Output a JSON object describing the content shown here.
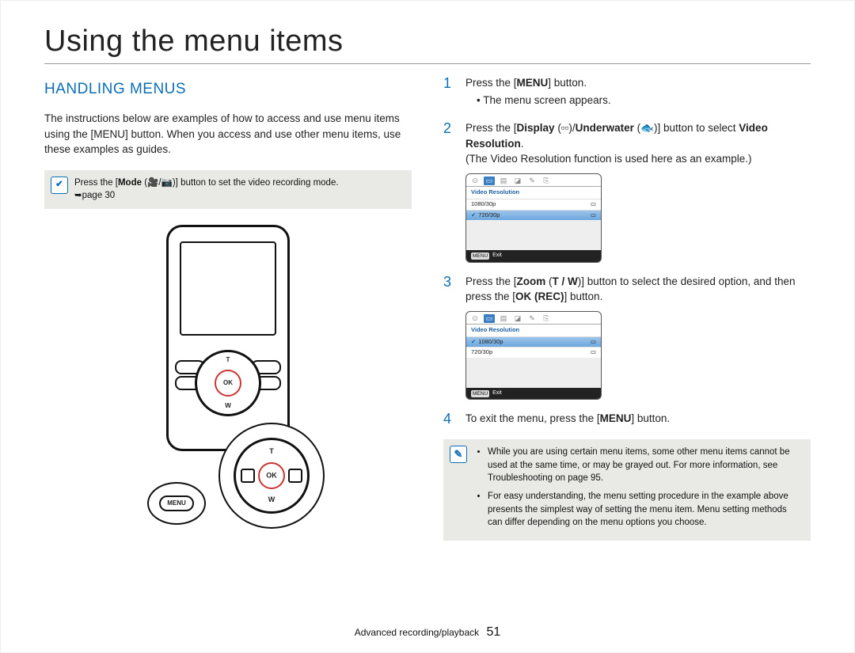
{
  "title": "Using the menu items",
  "section": "HANDLING MENUS",
  "intro": "The instructions below are examples of how to access and use menu items using the [MENU] button. When you access and use other menu items, use these examples as guides.",
  "mode_note": {
    "line1_a": "Press the [",
    "line1_b": "Mode",
    "line1_c": " (🎥/📷)] button to set the video recording mode.",
    "page_ref": "➥page 30"
  },
  "device": {
    "menu_label": "MENU",
    "t": "T",
    "w": "W",
    "ok": "OK"
  },
  "steps": {
    "s1": {
      "num": "1",
      "text_a": "Press the [",
      "text_b": "MENU",
      "text_c": "] button.",
      "bullet": "The menu screen appears."
    },
    "s2": {
      "num": "2",
      "text_a": "Press the [",
      "text_b": "Display",
      "text_c": " (▫▫)/",
      "text_d": "Underwater",
      "text_e": " (🐟)] button to select ",
      "text_f": "Video Resolution",
      "text_g": ".",
      "paren": "(The Video Resolution function is used here as an example.)"
    },
    "s3": {
      "num": "3",
      "text_a": "Press the [",
      "text_b": "Zoom",
      "text_c": " (",
      "text_d": "T / W",
      "text_e": ")] button to select the desired option, and then press the [",
      "text_f": "OK (REC)",
      "text_g": "] button."
    },
    "s4": {
      "num": "4",
      "text_a": "To exit the menu, press the [",
      "text_b": "MENU",
      "text_c": "] button."
    }
  },
  "mini1": {
    "title": "Video Resolution",
    "row1": "1080/30p",
    "row2": "720/30p",
    "exit_btn": "MENU",
    "exit": "Exit"
  },
  "mini2": {
    "title": "Video Resolution",
    "row1": "1080/30p",
    "row2": "720/30p",
    "exit_btn": "MENU",
    "exit": "Exit"
  },
  "tips": {
    "t1": "While you are using certain menu items, some other menu items cannot be used at the same time, or may be grayed out. For more information, see Troubleshooting on page 95.",
    "t2": "For easy understanding, the menu setting procedure in the example above presents the simplest way of setting the menu item. Menu setting methods can differ depending on the menu options you choose."
  },
  "footer": {
    "section": "Advanced recording/playback",
    "page": "51"
  }
}
